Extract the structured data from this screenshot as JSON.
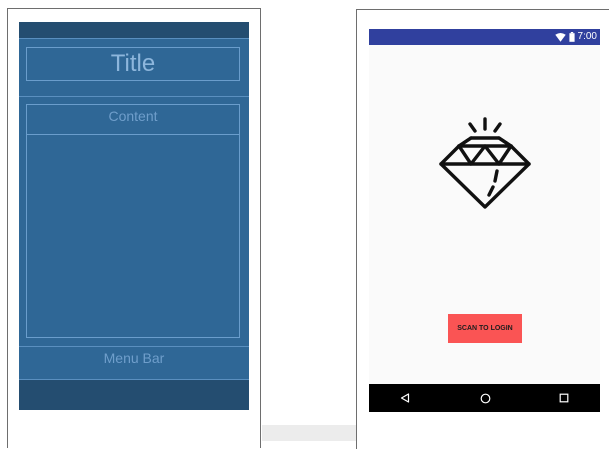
{
  "blueprint": {
    "title": "Title",
    "content_label": "Content",
    "menu_bar_label": "Menu Bar"
  },
  "phone": {
    "status_time": "7:00",
    "status_icons": [
      "wifi-icon",
      "battery-icon"
    ],
    "status_bar_color": "#30409e",
    "logo_icon": "diamond-icon",
    "scan_button_label": "SCAN TO LOGIN",
    "scan_button_color": "#fa5454",
    "nav_buttons": [
      "back-icon",
      "home-icon",
      "recents-icon"
    ]
  }
}
